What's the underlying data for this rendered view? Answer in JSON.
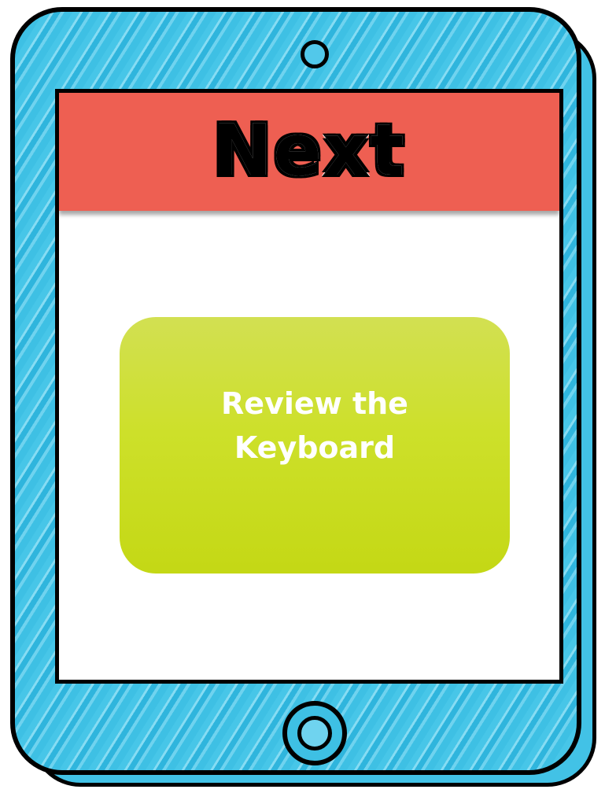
{
  "screen": {
    "header_title": "Next",
    "button_label": "Review the Keyboard"
  },
  "colors": {
    "tablet_body": "#3ec0e4",
    "header_band": "#ee5f52",
    "button_fill": "#cde02a"
  },
  "icons": {
    "camera": "camera-icon",
    "home": "home-button-icon"
  }
}
